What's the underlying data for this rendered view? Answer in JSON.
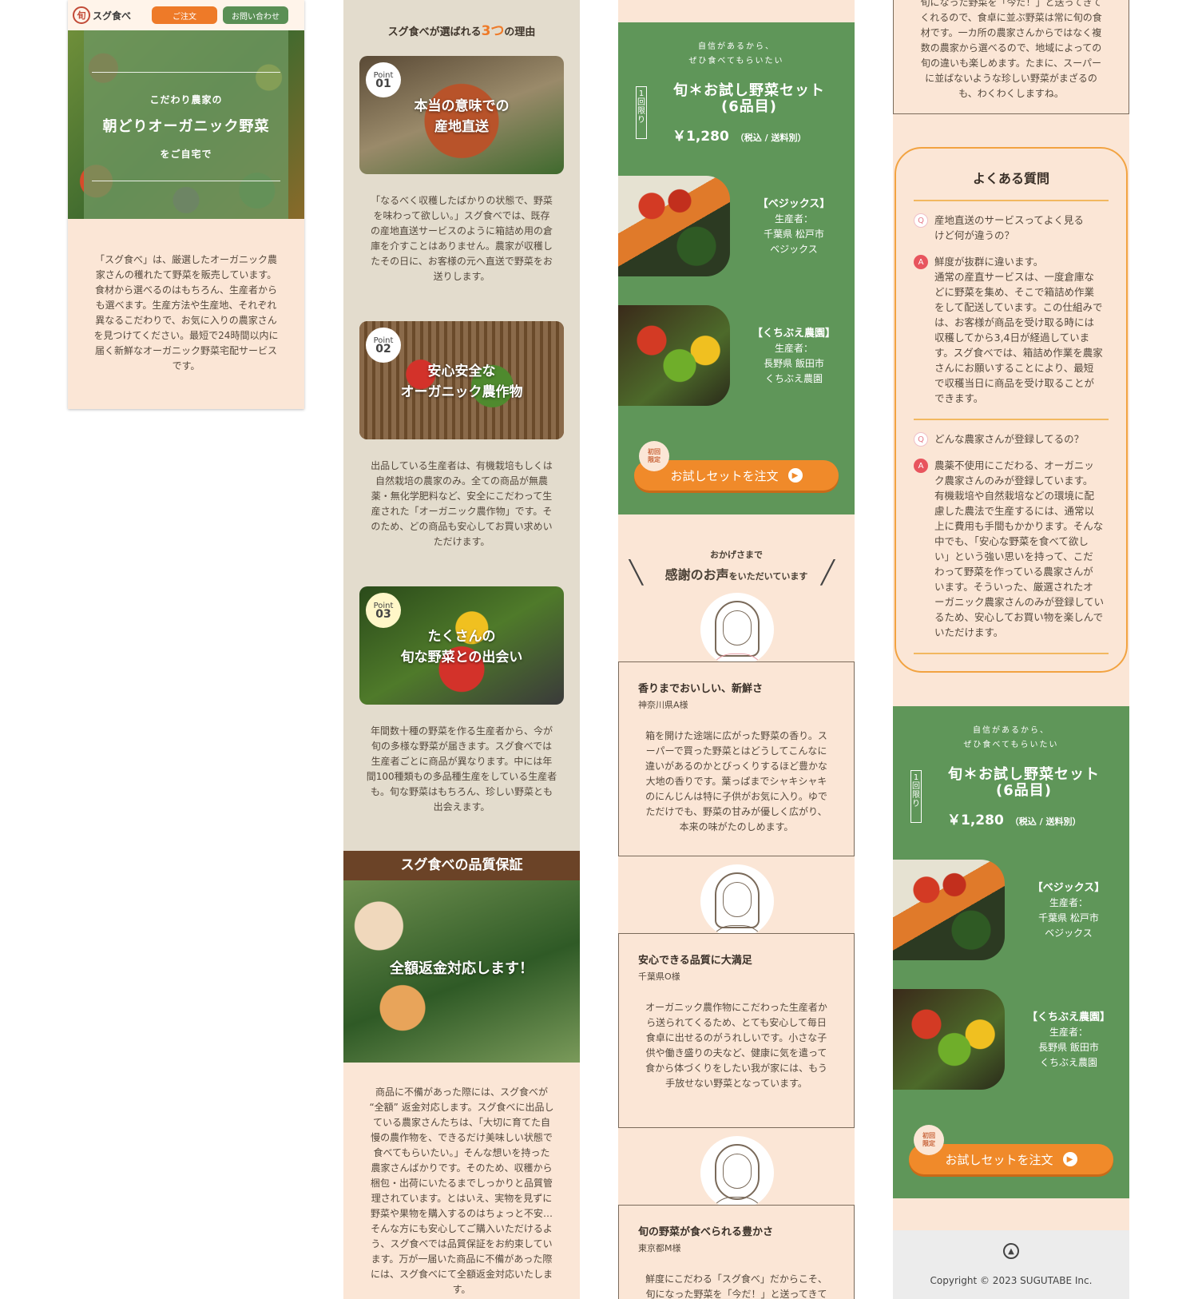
{
  "header": {
    "logo_mark": "旬",
    "logo_name": "スグ食べ",
    "order_label": "ご注文",
    "contact_label": "お問い合わせ"
  },
  "hero": {
    "line1": "こだわり農家の",
    "line2": "朝どりオーガニック野菜",
    "line3": "をご自宅で"
  },
  "intro": "「スグ食べ」は、厳選したオーガニック農\n家さんの穫れたて野菜を販売しています。\n食材から選べるのはもちろん、生産者から\nも選べます。生産方法や生産地、それぞれ\n異なるこだわりで、お気に入りの農家さん\nを見つけてください。最短で24時間以内に\n届く新鮮なオーガニック野菜宅配サービス\nです。",
  "reasons": {
    "title_pre": "スグ食べが選ばれる",
    "title_num": "3つ",
    "title_post": "の理由",
    "points": [
      {
        "label": "Point",
        "num": "01",
        "caption": "本当の意味での\n産地直送",
        "text": "「なるべく収穫したばかりの状態で、野菜\nを味わって欲しい。」スグ食べでは、既存\nの産地直送サービスのように箱詰め用の倉\n庫を介すことはありません。農家が収穫し\nたその日に、お客様の元へ直送で野菜をお\n送りします。"
      },
      {
        "label": "Point",
        "num": "02",
        "caption": "安心安全な\nオーガニック農作物",
        "text": "出品している生産者は、有機栽培もしくは\n自然栽培の農家のみ。全ての商品が無農\n薬・無化学肥料など、安全にこだわって生\n産された「オーガニック農作物」です。そ\nのため、どの商品も安心してお買い求めい\nただけます。"
      },
      {
        "label": "Point",
        "num": "03",
        "caption": "たくさんの\n旬な野菜との出会い",
        "text": "年間数十種の野菜を作る生産者から、今が\n旬の多様な野菜が届きます。スグ食べでは\n生産者ごとに商品が異なります。中には年\n間100種類もの多品種生産をしている生産者\nも。旬な野菜はもちろん、珍しい野菜とも\n出会えます。"
      }
    ]
  },
  "quality": {
    "title": "スグ食べの品質保証",
    "caption": "全額返金対応します！",
    "text": "商品に不備があった際には、スグ食べが\n“全額” 返金対応します。スグ食べに出品し\nている農家さんたちは、「大切に育てた自\n慢の農作物を、できるだけ美味しい状態で\n食べてもらいたい。」そんな想いを持った\n農家さんばかりです。そのため、収穫から\n梱包・出荷にいたるまでしっかりと品質管\n理されています。とはいえ、実物を見ずに\n野菜や果物を購入するのはちょっと不安…\nそんな方にも安心してご購入いただけるよ\nう、スグ食べでは品質保証をお約束してい\nます。万が一届いた商品に不備があった際\nには、スグ食べにて全額返金対応いたしま\nす。"
  },
  "offer": {
    "sub": "自信があるから、\nぜひ食べてもらいたい",
    "once": "1回限り",
    "name": "旬＊お試し野菜セット\n(6品目)",
    "price": "￥1,280",
    "price_note": "（税込 / 送料別）",
    "producers": [
      {
        "name": "【ベジックス】",
        "detail": "生産者：\n千葉県 松戸市\nベジックス"
      },
      {
        "name": "【くちぶえ農園】",
        "detail": "生産者：\n長野県 飯田市\nくちぶえ農園"
      }
    ],
    "badge": "初回\n限定",
    "cta": "お試しセットを注文",
    "cta_icon": "play-icon"
  },
  "voices": {
    "head_small": "おかげさまで",
    "head_large": "感謝のお声",
    "head_suffix": "をいただいています",
    "items": [
      {
        "title": "香りまでおいしい、新鮮さ",
        "name": "神奈川県A様",
        "text": "箱を開けた途端に広がった野菜の香り。ス\nーパーで買った野菜とはどうしてこんなに\n違いがあるのかとびっくりするほど豊かな\n大地の香りです。葉っぱまでシャキシャキ\nのにんじんは特に子供がお気に入り。ゆで\nただけでも、野菜の甘みが優しく広がり、\n本来の味がたのしめます。"
      },
      {
        "title": "安心できる品質に大満足",
        "name": "千葉県O様",
        "text": "オーガニック農作物にこだわった生産者か\nら送られてくるため、とても安心して毎日\n食卓に出せるのがうれしいです。小さな子\n供や働き盛りの夫など、健康に気を遣って\n食から体づくりをしたい我が家には、もう\n手放せない野菜となっています。"
      },
      {
        "title": "旬の野菜が食べられる豊かさ",
        "name": "東京都M様",
        "text": "鮮度にこだわる「スグ食べ」だからこそ、\n旬になった野菜を「今だ！」と送ってきて"
      }
    ]
  },
  "voice_continued": "旬になった野菜を「今だ！」と送ってきて\nくれるので、食卓に並ぶ野菜は常に旬の食\n材です。一カ所の農家さんからではなく複\n数の農家から選べるので、地域によっての\n旬の違いも楽しめます。たまに、スーパー\nに並ばないような珍しい野菜がまざるの\nも、わくわくしますね。",
  "faq": {
    "title": "よくある質問",
    "q_icon": "Q",
    "a_icon": "A",
    "items": [
      {
        "q": "産地直送のサービスってよく見る\nけど何が違うの？",
        "a": "鮮度が抜群に違います。\n通常の産直サービスは、一度倉庫な\nどに野菜を集め、そこで箱詰め作業\nをして配送しています。この仕組みで\nは、お客様が商品を受け取る時には\n収穫してから3,4日が経過していま\nす。スグ食べでは、箱詰め作業を農家\nさんにお願いすることにより、最短\nで収穫当日に商品を受け取ることが\nできます。"
      },
      {
        "q": "どんな農家さんが登録してるの？",
        "a": "農薬不使用にこだわる、オーガニッ\nク農家さんのみが登録しています。\n有機栽培や自然栽培などの環境に配\n慮した農法で生産するには、通常以\n上に費用も手間もかかります。そんな\n中でも、「安心な野菜を食べて欲し\nい」という強い思いを持って、こだ\nわって野菜を作っている農家さんが\nいます。そういった、厳選されたオ\nーガニック農家さんのみが登録してい\nるため、安心してお買い物を楽しんで\nいただけます。"
      }
    ]
  },
  "footer": {
    "top_icon": "chevron-up-icon",
    "copyright": "Copyright © 2023 SUGUTABE Inc."
  }
}
